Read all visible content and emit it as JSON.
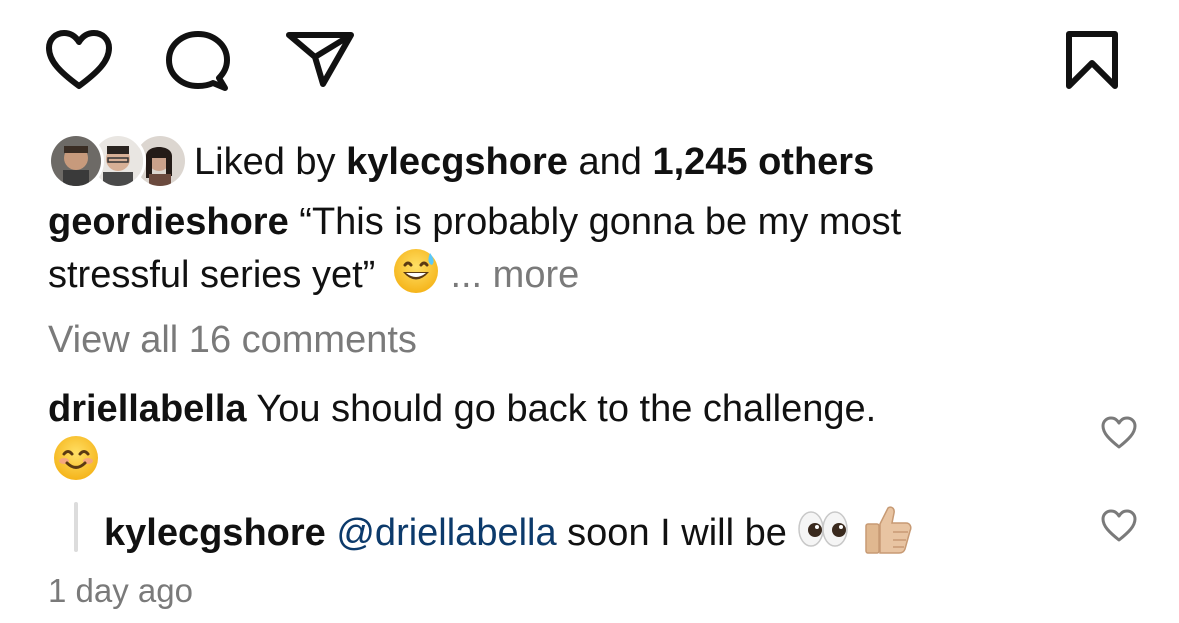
{
  "actions": {
    "like_icon": "heart-outline-icon",
    "comment_icon": "speech-bubble-icon",
    "share_icon": "paper-plane-icon",
    "save_icon": "bookmark-icon"
  },
  "likes": {
    "prefix": "Liked by",
    "user": "kylecgshore",
    "conjunction": "and",
    "others": "1,245 others"
  },
  "caption": {
    "username": "geordieshore",
    "line1": "“This is probably gonna be my most",
    "line2": "stressful series yet”",
    "emoji": "grinning-face-with-sweat-emoji",
    "more": "... more"
  },
  "view_comments": "View all 16 comments",
  "comments": [
    {
      "username": "driellabella",
      "text": "You should go back to the challenge.",
      "emoji": "smiling-face-with-smiling-eyes-emoji",
      "like_icon": "small-heart-icon"
    },
    {
      "username": "kylecgshore",
      "mention": "@driellabella",
      "text": "soon I will be",
      "emojis": [
        "eyes-emoji",
        "thumbs-up-emoji"
      ],
      "like_icon": "small-heart-icon"
    }
  ],
  "timestamp": "1 day ago"
}
